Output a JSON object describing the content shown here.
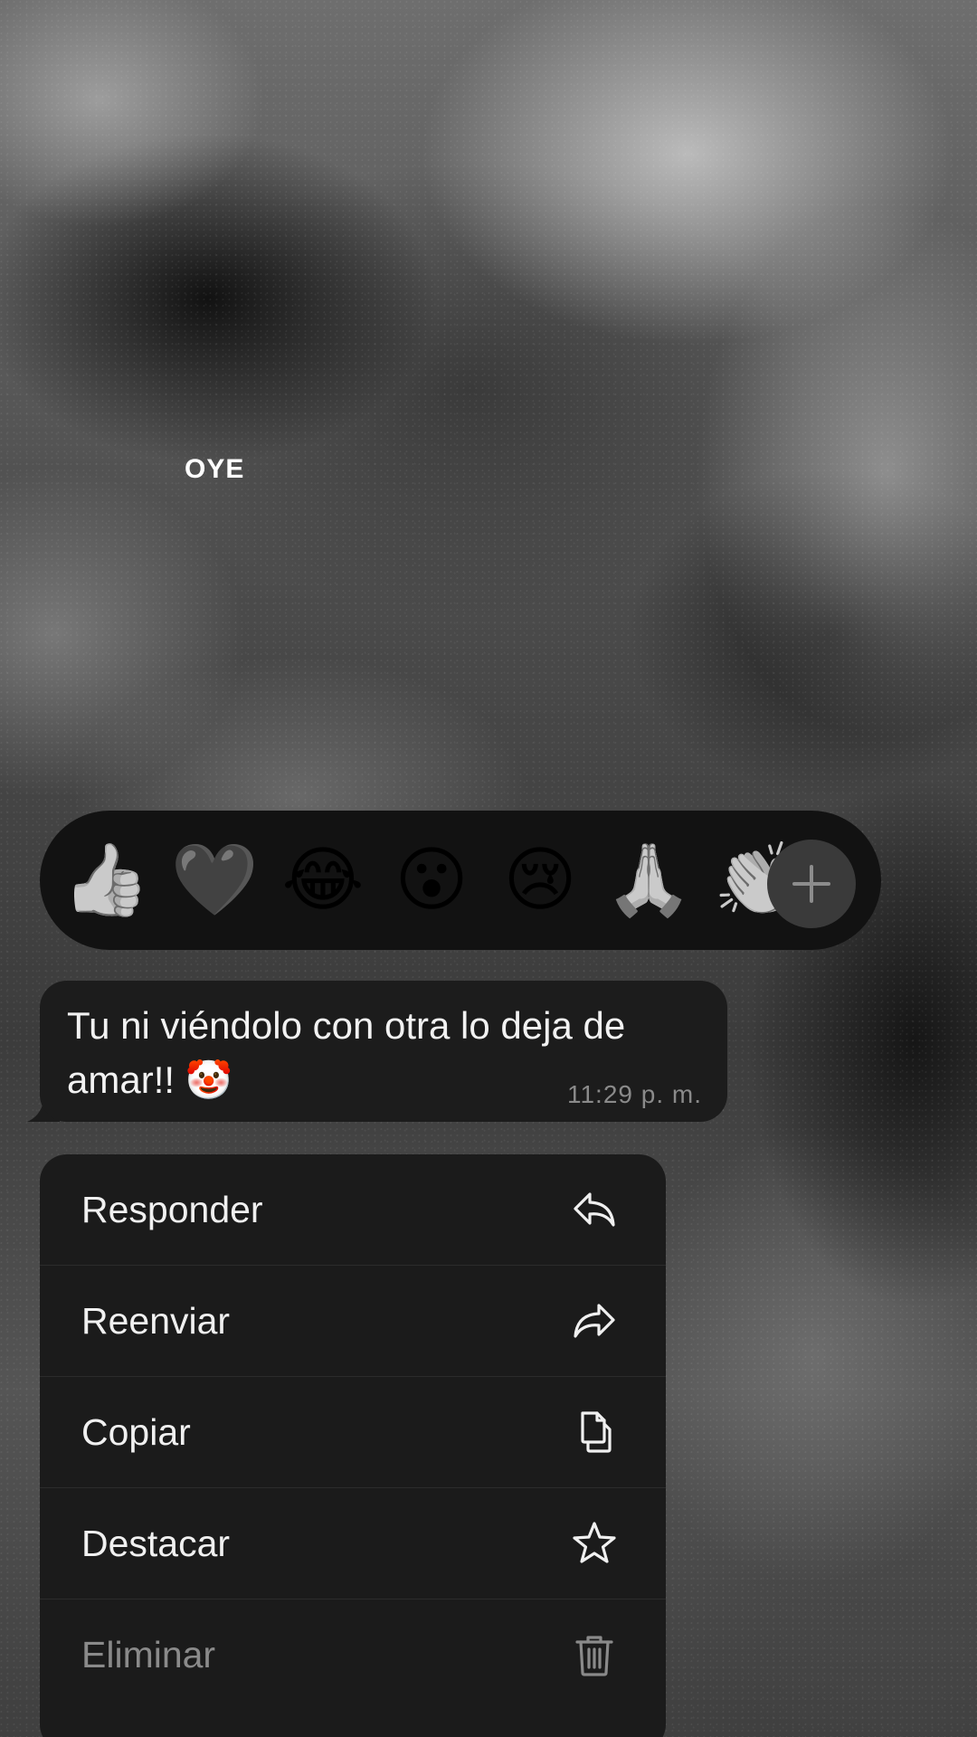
{
  "overlay": {
    "text": "OYE"
  },
  "reactions": {
    "items": [
      {
        "emoji": "👍",
        "name": "thumbs-up"
      },
      {
        "emoji": "🖤",
        "name": "heart"
      },
      {
        "emoji": "😂",
        "name": "tears-of-joy"
      },
      {
        "emoji": "😮",
        "name": "surprised"
      },
      {
        "emoji": "😢",
        "name": "crying"
      },
      {
        "emoji": "🙏",
        "name": "folded-hands"
      },
      {
        "emoji": "👏",
        "name": "clapping-hands"
      }
    ],
    "more_icon": "plus-icon"
  },
  "message": {
    "text": "Tu ni viéndolo con otra lo deja de amar!! 🤡",
    "time": "11:29 p. m."
  },
  "menu": {
    "items": [
      {
        "label": "Responder",
        "icon": "reply-icon",
        "disabled": false
      },
      {
        "label": "Reenviar",
        "icon": "forward-icon",
        "disabled": false
      },
      {
        "label": "Copiar",
        "icon": "copy-icon",
        "disabled": false
      },
      {
        "label": "Destacar",
        "icon": "star-icon",
        "disabled": false
      },
      {
        "label": "Eliminar",
        "icon": "trash-icon",
        "disabled": true
      }
    ]
  }
}
